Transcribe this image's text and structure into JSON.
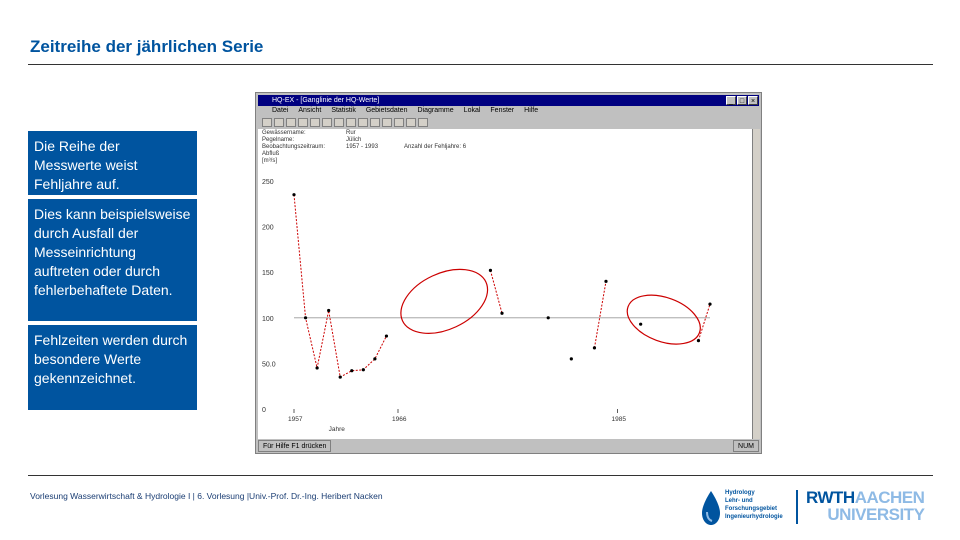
{
  "slide": {
    "title": "Zeitreihe der jährlichen Serie"
  },
  "screenshot": {
    "window_title": "HQ-EX - [Ganglinie der HQ-Werte]",
    "window_buttons": [
      "_",
      "□",
      "×"
    ],
    "menu": [
      "Datei",
      "Ansicht",
      "Statistik",
      "Gebietsdaten",
      "Diagramme",
      "Lokal",
      "Fenster",
      "Hilfe"
    ],
    "info_labels": "Gewässername:\nPegelname:\nBeobachtungszeitraum:\nAbfluß\n[m³/s]",
    "info_values": "Rur\nJülich\n1957 - 1993",
    "info_extra": "Anzahl der Fehljahre: 6",
    "status_left": "Für Hilfe F1 drücken",
    "status_right": "NUM",
    "y_ticks": [
      "250",
      "200",
      "150",
      "100",
      "50.0",
      "0"
    ],
    "x_ticks": [
      "1957",
      "1966",
      "1985"
    ],
    "x_sublabel": "Jahre"
  },
  "chart_data": {
    "type": "line",
    "x": [
      1957,
      1958,
      1959,
      1960,
      1961,
      1962,
      1963,
      1964,
      1965,
      1966,
      1967,
      1968,
      1969,
      1970,
      1971,
      1972,
      1973,
      1974,
      1975,
      1976,
      1977,
      1978,
      1979,
      1980,
      1981,
      1982,
      1983,
      1984,
      1985,
      1986,
      1987,
      1988,
      1989,
      1990,
      1991,
      1992,
      1993
    ],
    "series": [
      {
        "values": [
          235,
          100,
          45,
          108,
          35,
          42,
          43,
          55,
          80,
          null,
          null,
          null,
          null,
          null,
          null,
          null,
          null,
          152,
          105,
          null,
          null,
          null,
          100,
          null,
          55,
          null,
          67,
          140,
          null,
          null,
          93,
          null,
          null,
          null,
          null,
          75,
          115
        ]
      }
    ],
    "ylim": [
      0,
      250
    ],
    "xlim": [
      1957,
      1993
    ],
    "yticks": [
      0,
      50,
      100,
      150,
      200,
      250
    ],
    "reference_line": 100,
    "annotations": "two red ellipses marking the gaps (missing years)"
  },
  "text_boxes": [
    "Die Reihe der Messwerte weist Fehljahre auf.",
    "Dies kann beispielsweise durch Ausfall der Messeinrichtung auftreten oder durch fehlerbehaftete Daten.",
    "Fehlzeiten werden durch besondere Werte gekennzeichnet."
  ],
  "footer": {
    "text": "Vorlesung Wasserwirtschaft & Hydrologie I | 6. Vorlesung |Univ.-Prof. Dr.-Ing. Heribert Nacken",
    "hydro_logo": "Hydrology\nLehr- und\nForschungsgebiet\nIngenieurhydrologie",
    "rwth_l1a": "RWTH",
    "rwth_l1b": "AACHEN",
    "rwth_l2": "UNIVERSITY"
  },
  "colors": {
    "accent": "#00549f",
    "line": "#cc0000",
    "ellipse": "#cc0000"
  }
}
